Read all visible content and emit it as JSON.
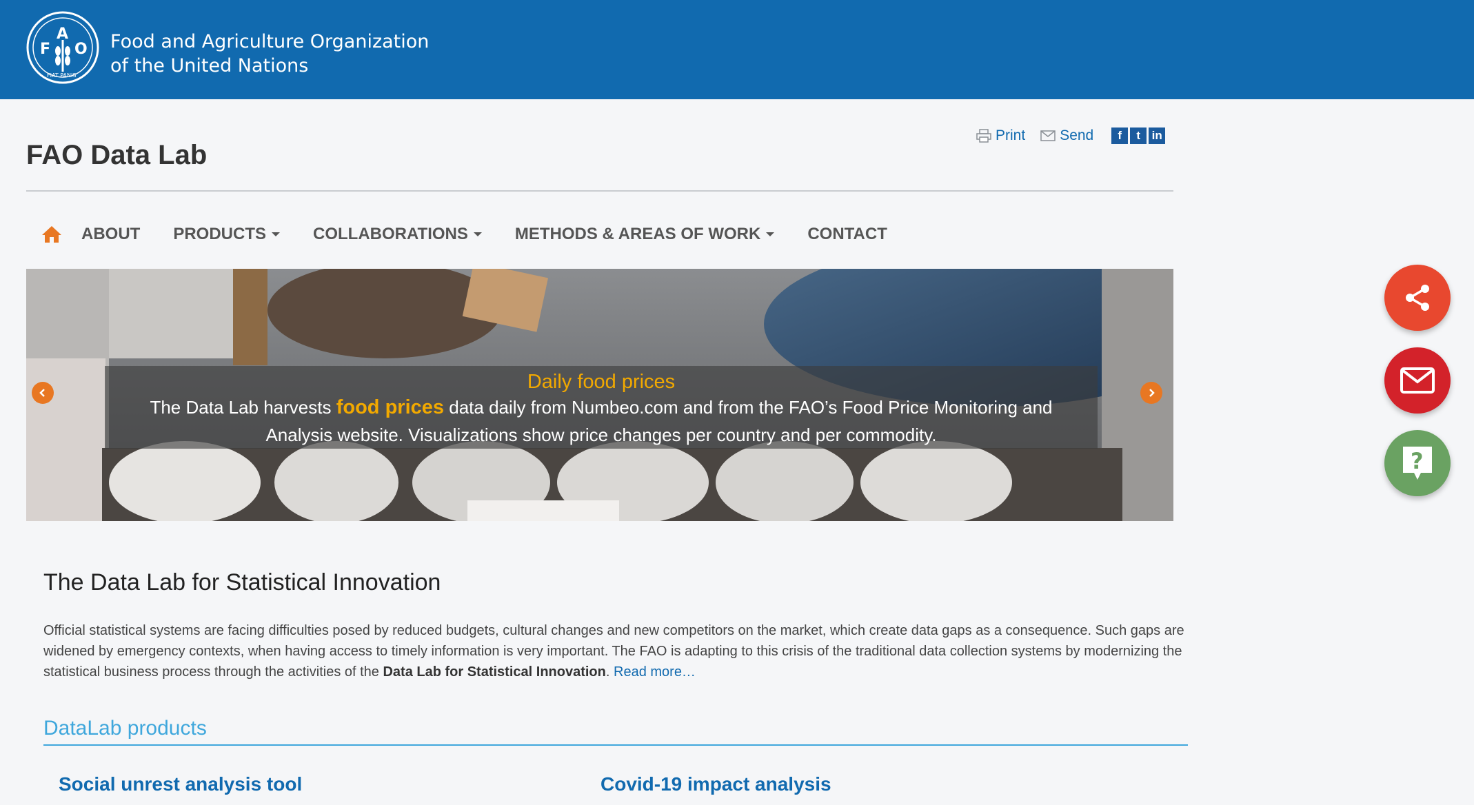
{
  "header": {
    "org_line1": "Food and Agriculture Organization",
    "org_line2": "of the United Nations",
    "logo_letters": [
      "F",
      "A",
      "O"
    ],
    "logo_motto": "FIAT PANIS"
  },
  "site_title": "FAO Data Lab",
  "tools": {
    "print": "Print",
    "send": "Send",
    "social": [
      "f",
      "t",
      "in"
    ]
  },
  "nav": {
    "items": [
      {
        "label": "ABOUT",
        "dropdown": false
      },
      {
        "label": "PRODUCTS",
        "dropdown": true
      },
      {
        "label": "COLLABORATIONS",
        "dropdown": true
      },
      {
        "label": "METHODS & AREAS OF WORK",
        "dropdown": true
      },
      {
        "label": "CONTACT",
        "dropdown": false
      }
    ]
  },
  "hero": {
    "title": "Daily food prices",
    "text_before": "The Data Lab harvests ",
    "highlight": "food prices",
    "text_after": " data daily from Numbeo.com and from the FAO’s Food Price Monitoring and Analysis website. Visualizations show price changes per country and per commodity."
  },
  "intro": {
    "title": "The Data Lab for Statistical Innovation",
    "paragraph": "Official statistical systems are facing difficulties posed by reduced budgets, cultural changes and new competitors on the market, which create data gaps as a consequence. Such gaps are widened by emergency contexts, when having access to timely information is very important. The FAO is adapting to this crisis of the traditional data collection systems by modernizing the statistical business process through the activities of the ",
    "bold": "Data Lab for Statistical Innovation",
    "period": ".",
    "read_more": "Read more…"
  },
  "products": {
    "title": "DataLab products",
    "items": [
      "Social unrest analysis tool",
      "Covid-19 impact analysis"
    ]
  },
  "colors": {
    "header_blue": "#116aaf",
    "accent_orange": "#e87722",
    "highlight_yellow": "#f2a900",
    "share_red": "#e8482f",
    "mail_red": "#d3222a",
    "help_green": "#6aa262",
    "products_blue": "#3fa7dc"
  },
  "floating_icons": [
    "share-icon",
    "mail-icon",
    "help-icon"
  ]
}
